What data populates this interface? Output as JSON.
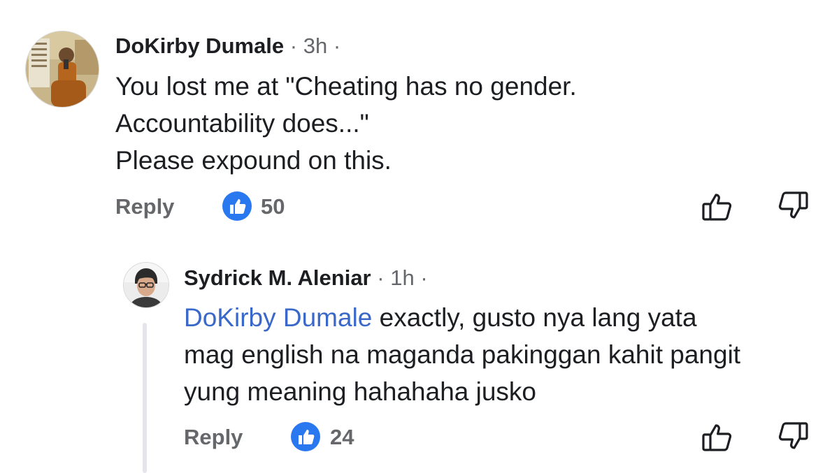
{
  "comments": [
    {
      "author": "DoKirby Dumale",
      "separator": "·",
      "time": "3h",
      "trailing_separator": "·",
      "lines": [
        "You lost me at \"Cheating has no gender.",
        "Accountability does...\"",
        "Please expound on this."
      ],
      "reply_label": "Reply",
      "like_count": "50"
    },
    {
      "author": "Sydrick M. Aleniar",
      "separator": "·",
      "time": "1h",
      "trailing_separator": "·",
      "mention": "DoKirby Dumale",
      "lines": [
        " exactly, gusto nya lang yata",
        "mag english na maganda pakinggan kahit pangit",
        "yung meaning hahahaha jusko"
      ],
      "reply_label": "Reply",
      "like_count": "24"
    }
  ],
  "icons": {
    "like_badge": "thumbs-up-badge-icon",
    "like_button": "thumbs-up-outline-icon",
    "dislike_button": "thumbs-down-outline-icon"
  },
  "colors": {
    "like_badge": "#2a78ef",
    "mention": "#3a68c9",
    "secondary_text": "#65676b",
    "thread_line": "#e4e6eb"
  }
}
